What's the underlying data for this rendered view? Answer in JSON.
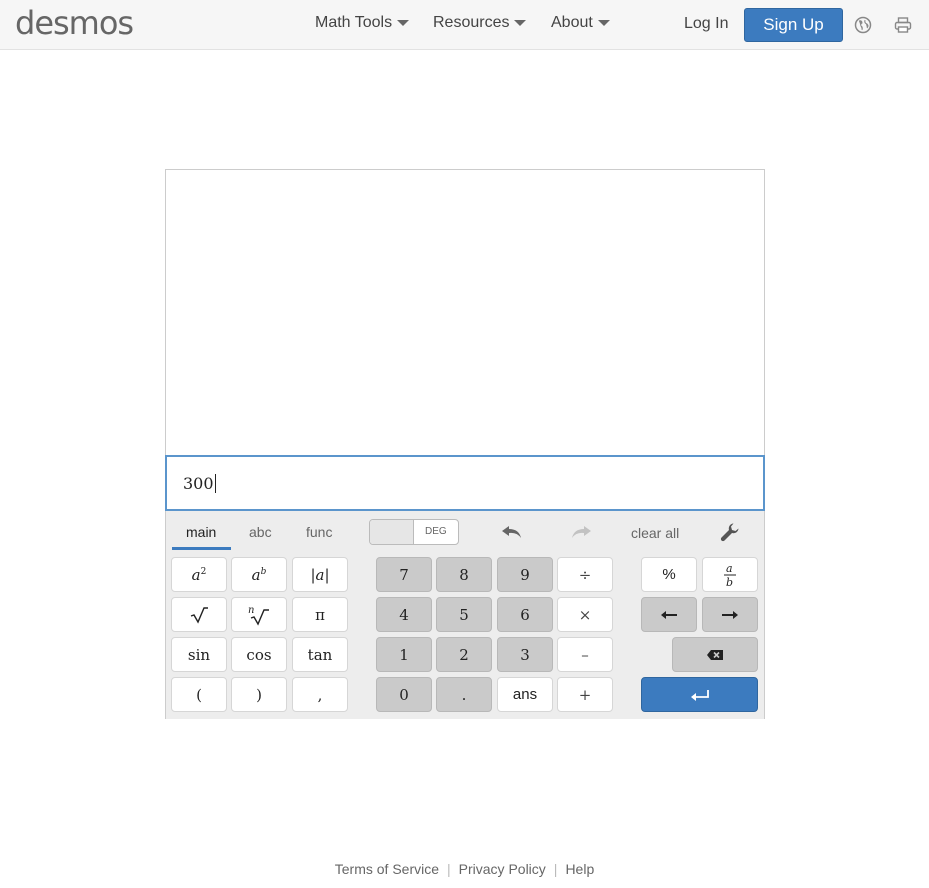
{
  "header": {
    "logo": "desmos",
    "nav": [
      {
        "label": "Math Tools"
      },
      {
        "label": "Resources"
      },
      {
        "label": "About"
      }
    ],
    "login": "Log In",
    "signup": "Sign Up"
  },
  "calculator": {
    "input_value": "300",
    "tabs": [
      "main",
      "abc",
      "func"
    ],
    "active_tab": "main",
    "angle_mode": "DEG",
    "clear_all": "clear all",
    "keys": {
      "sin": "sin",
      "cos": "cos",
      "tan": "tan",
      "lparen": "(",
      "rparen": ")",
      "comma": ",",
      "pi": "π",
      "seven": "7",
      "eight": "8",
      "nine": "9",
      "four": "4",
      "five": "5",
      "six": "6",
      "one": "1",
      "two": "2",
      "three": "3",
      "zero": "0",
      "dot": ".",
      "ans": "ans",
      "divide": "÷",
      "times": "×",
      "minus": "–",
      "plus": "+",
      "percent": "%"
    }
  },
  "footer": {
    "links": [
      "Terms of Service",
      "Privacy Policy",
      "Help"
    ]
  },
  "colors": {
    "accent": "#3c7bbf",
    "gray_key": "#cacaca",
    "keypad_bg": "#ededed"
  }
}
